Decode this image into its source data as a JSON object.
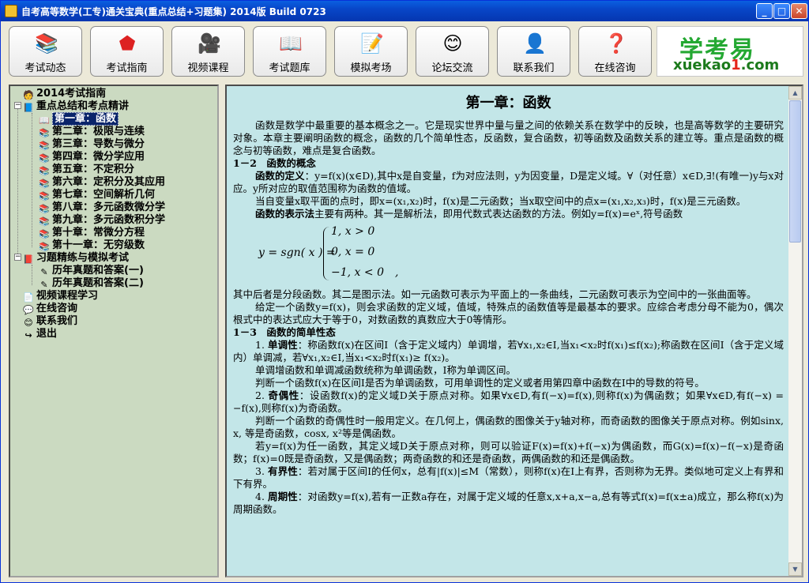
{
  "window": {
    "title": "自考高等数学(工专)通关宝典(重点总结+习题集) 2014版 Build 0723"
  },
  "toolbar": {
    "buttons": [
      {
        "label": "考试动态",
        "icon": "books-icon",
        "glyph": "📚"
      },
      {
        "label": "考试指南",
        "icon": "pentagon-icon",
        "glyph": "⬟"
      },
      {
        "label": "视频课程",
        "icon": "video-camera-icon",
        "glyph": "🎥"
      },
      {
        "label": "考试题库",
        "icon": "open-book-icon",
        "glyph": "📖"
      },
      {
        "label": "模拟考场",
        "icon": "exam-sheet-icon",
        "glyph": "📝"
      },
      {
        "label": "论坛交流",
        "icon": "smiley-icon",
        "glyph": "😊"
      },
      {
        "label": "联系我们",
        "icon": "contact-person-icon",
        "glyph": "👤"
      },
      {
        "label": "在线咨询",
        "icon": "question-mark-icon",
        "glyph": "❓"
      }
    ],
    "logo": {
      "cn": "学考易",
      "en_a": "xuekao",
      "en_b": "1",
      "en_c": ".com"
    }
  },
  "tree": {
    "items": [
      {
        "label": "2014考试指南"
      },
      {
        "label": "重点总结和考点精讲"
      },
      {
        "label": "第一章：函数"
      },
      {
        "label": "第二章：极限与连续"
      },
      {
        "label": "第三章：导数与微分"
      },
      {
        "label": "第四章：微分学应用"
      },
      {
        "label": "第五章：不定积分"
      },
      {
        "label": "第六章：定积分及其应用"
      },
      {
        "label": "第七章：空间解析几何"
      },
      {
        "label": "第八章：多元函数微分学"
      },
      {
        "label": "第九章：多元函数积分学"
      },
      {
        "label": "第十章：常微分方程"
      },
      {
        "label": "第十一章：无穷级数"
      },
      {
        "label": "习题精练与模拟考试"
      },
      {
        "label": "历年真题和答案(一)"
      },
      {
        "label": "历年真题和答案(二)"
      },
      {
        "label": "视频课程学习"
      },
      {
        "label": "在线咨询"
      },
      {
        "label": "联系我们"
      },
      {
        "label": "退出"
      }
    ]
  },
  "doc": {
    "title": "第一章：函数",
    "p1": "函数是数学中最重要的基本概念之一。它是现实世界中量与量之间的依赖关系在数学中的反映，也是高等数学的主要研究对象。本章主要阐明函数的概念，函数的几个简单性态，反函数，复合函数，初等函数及函数关系的建立等。重点是函数的概念与初等函数，难点是复合函数。",
    "s12": "1－2　函数的概念",
    "p2b": "函数的定义",
    "p2": "：y=f(x)(x∈D),其中x是自变量，f为对应法则，y为因变量，D是定义域。∀（对任意）x∈D,∃!(有唯一)y与x对应。y所对应的取值范围称为函数的值域。",
    "p3": "当自变量x取平面的点时，即x=(x₁,x₂)时，f(x)是二元函数；当x取空间中的点x=(x₁,x₂,x₃)时，f(x)是三元函数。",
    "p4b": "函数的表示法",
    "p4": "主要有两种。其一是解析法，即用代数式表达函数的方法。例如y=f(x)=eˣ,符号函数",
    "f_lhs": "y = sgn( x ) =",
    "f_c1": "1, x > 0",
    "f_c2": "0, x = 0",
    "f_c3": "−1, x < 0　,",
    "p5": "其中后者是分段函数。其二是图示法。如一元函数可表示为平面上的一条曲线，二元函数可表示为空间中的一张曲面等。",
    "p6": "给定一个函数y=f(x)，则会求函数的定义域，值域，特殊点的函数值等是最基本的要求。应综合考虑分母不能为0，偶次根式中的表达式应大于等于0，对数函数的真数应大于0等情形。",
    "s13": "1－3　函数的简单性态",
    "p7a": "1. ",
    "p7b": "单调性",
    "p7": "：称函数f(x)在区间I（含于定义域内）单调增，若∀x₁,x₂∈I,当x₁<x₂时f(x₁)≤f(x₂);称函数在区间I（含于定义域内）单调减，若∀x₁,x₂∈I,当x₁<x₂时f(x₁)≥ f(x₂)。",
    "p8": "单调增函数和单调减函数统称为单调函数，I称为单调区间。",
    "p9": "判断一个函数f(x)在区间I是否为单调函数，可用单调性的定义或者用第四章中函数在I中的导数的符号。",
    "p10a": "2. ",
    "p10b": "奇偶性",
    "p10": "：设函数f(x)的定义域D关于原点对称。如果∀x∈D,有f(−x)=f(x),则称f(x)为偶函数；如果∀x∈D,有f(−x) = −f(x),则称f(x)为奇函数。",
    "p11": "判断一个函数的奇偶性时一般用定义。在几何上，偶函数的图像关于y轴对称，而奇函数的图像关于原点对称。例如sinx, x, 等是奇函数，cosx, x²等是偶函数。",
    "p12": "若y=f(x)为任一函数，其定义域D关于原点对称，则可以验证F(x)=f(x)+f(−x)为偶函数，而G(x)=f(x)−f(−x)是奇函数；f(x)=0既是奇函数，又是偶函数；两奇函数的和还是奇函数，两偶函数的和还是偶函数。",
    "p13a": "3. ",
    "p13b": "有界性",
    "p13": "：若对属于区间I的任何x，总有|f(x)|≤M（常数），则称f(x)在I上有界，否则称为无界。类似地可定义上有界和下有界。",
    "p14a": "4. ",
    "p14b": "周期性",
    "p14": "：对函数y=f(x),若有一正数a存在，对属于定义域的任意x,x+a,x−a,总有等式f(x)=f(x±a)成立，那么称f(x)为周期函数。"
  }
}
